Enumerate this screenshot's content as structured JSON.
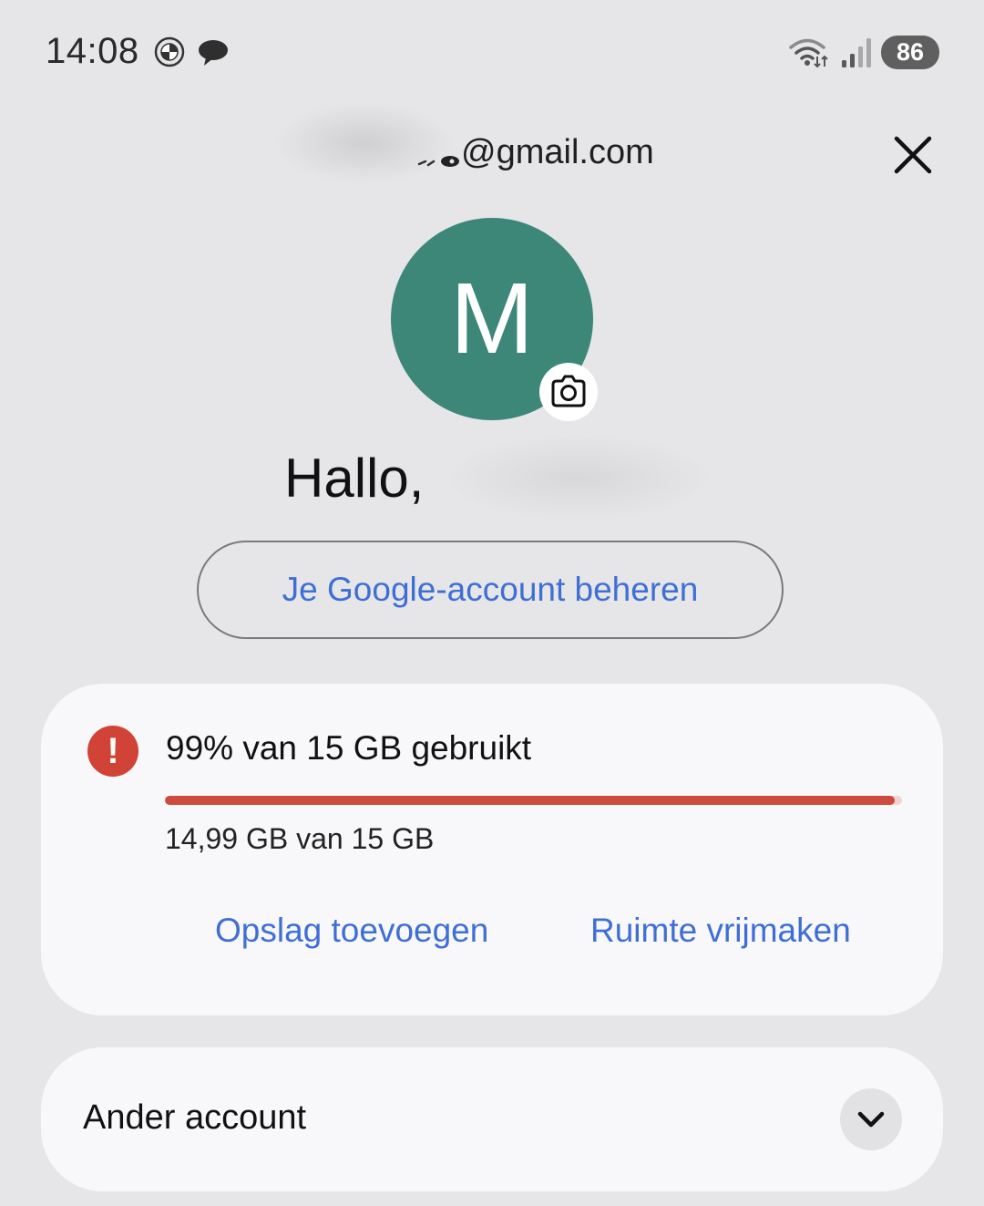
{
  "status_bar": {
    "time": "14:08",
    "battery": "86",
    "icons": [
      "bmw-logo-icon",
      "chat-bubble-icon",
      "wifi-icon",
      "signal-icon",
      "battery-icon"
    ]
  },
  "header": {
    "email": "@gmail.com",
    "close_icon": "close-icon"
  },
  "profile": {
    "avatar_letter": "M",
    "avatar_color": "#3d8779",
    "greeting": "Hallo,",
    "manage_button": "Je Google-account beheren"
  },
  "storage": {
    "title": "99% van 15 GB gebruikt",
    "used_fraction": 0.99,
    "detail": "14,99 GB van 15 GB",
    "alert_symbol": "!",
    "add_button": "Opslag toevoegen",
    "free_button": "Ruimte vrijmaken",
    "accent_color": "#cd4a3f",
    "link_color": "#3f6fd4"
  },
  "other_account": {
    "label": "Ander account"
  }
}
